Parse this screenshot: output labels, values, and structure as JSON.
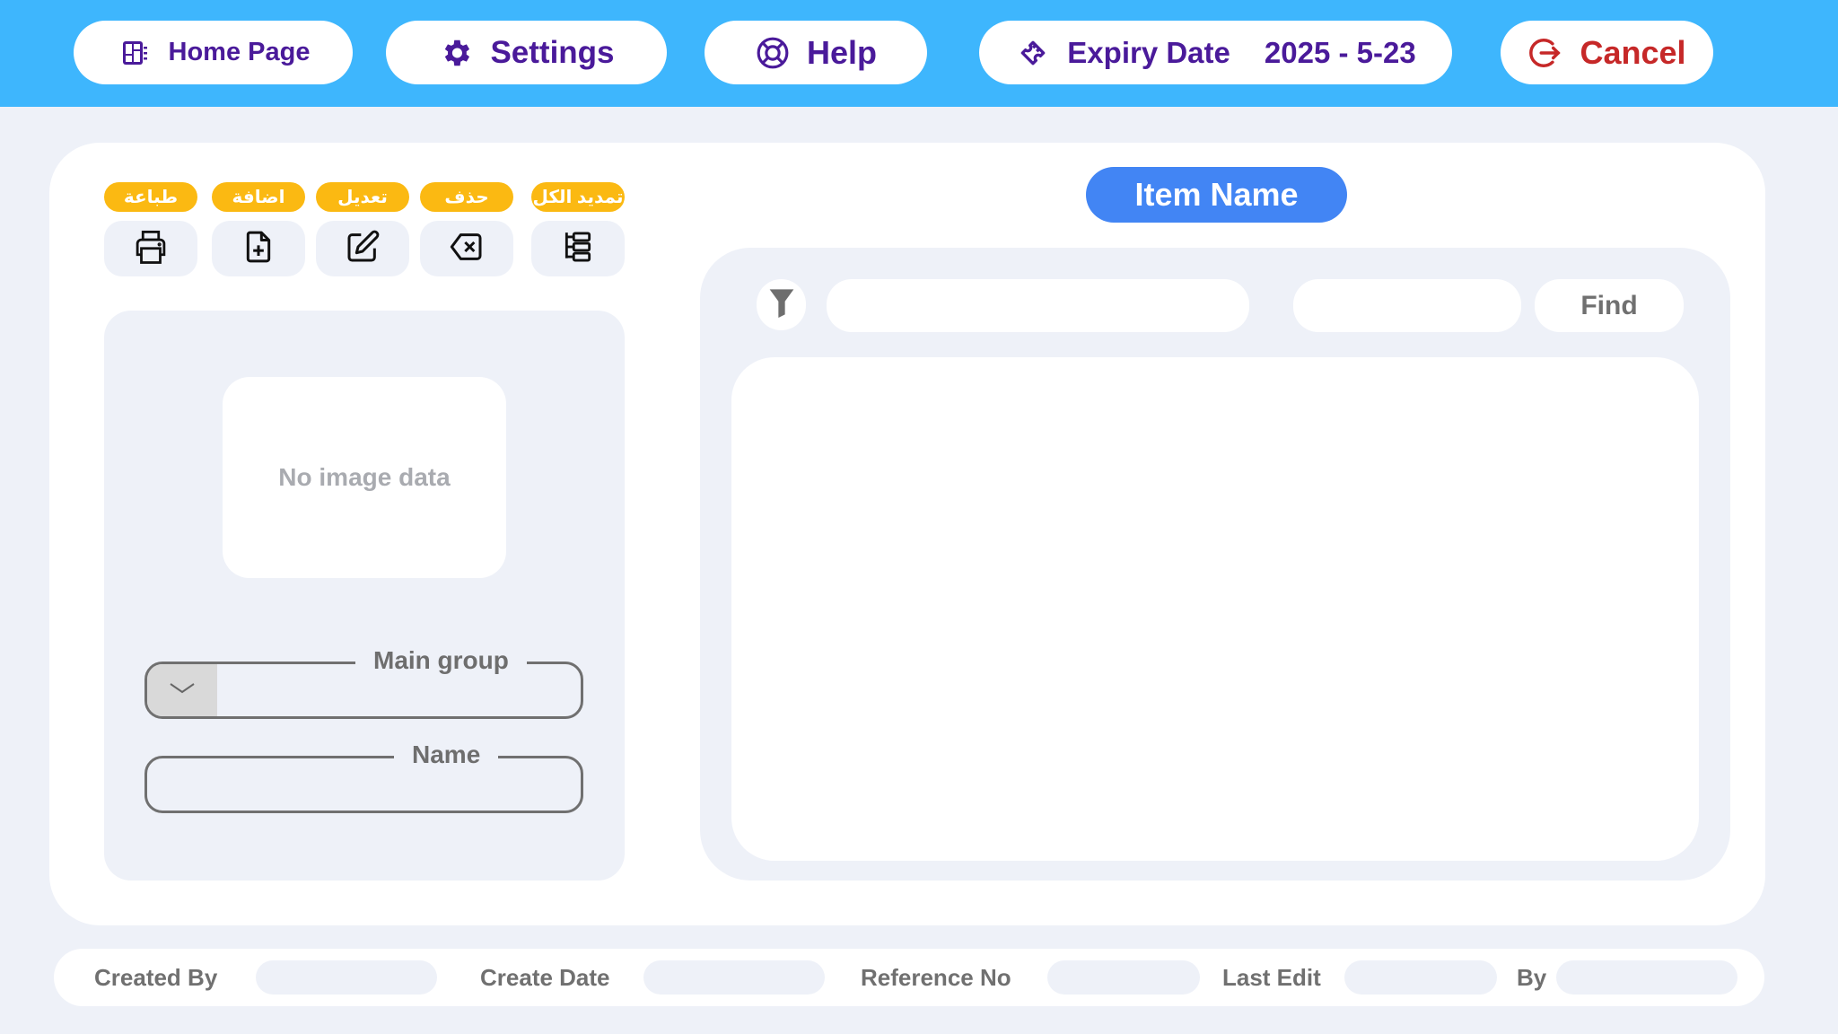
{
  "topbar": {
    "home_label": "Home Page",
    "home_icon": "dashboard-icon",
    "settings_label": "Settings",
    "settings_icon": "gear-icon",
    "help_label": "Help",
    "help_icon": "lifebuoy-icon",
    "expiry_label": "Expiry Date",
    "expiry_value": "2025 - 5-23",
    "expiry_icon": "ticket-icon",
    "cancel_label": "Cancel",
    "cancel_icon": "exit-icon"
  },
  "actions": [
    {
      "label": "طباعة",
      "icon": "printer-icon"
    },
    {
      "label": "اضافة",
      "icon": "file-add-icon"
    },
    {
      "label": "تعديل",
      "icon": "edit-icon"
    },
    {
      "label": "حذف",
      "icon": "delete-icon"
    },
    {
      "label": "تمديد الكل",
      "icon": "tree-list-icon"
    }
  ],
  "left_panel": {
    "image_placeholder": "No image data",
    "main_group_label": "Main group",
    "main_group_value": "",
    "name_label": "Name",
    "name_value": ""
  },
  "right_panel": {
    "title": "Item Name",
    "search_value": "",
    "search_secondary_value": "",
    "find_label": "Find",
    "results": []
  },
  "footer": {
    "created_by_label": "Created By",
    "created_by_value": "",
    "create_date_label": "Create Date",
    "create_date_value": "",
    "reference_no_label": "Reference No",
    "reference_no_value": "",
    "last_edit_label": "Last Edit",
    "last_edit_value": "",
    "by_label": "By",
    "by_value": ""
  },
  "colors": {
    "topbar": "#3eb6fd",
    "primary_text": "#4a1a9a",
    "cancel": "#c62828",
    "tag": "#fbb912",
    "title_pill": "#4285f4",
    "panel_bg": "#eef1f8"
  }
}
